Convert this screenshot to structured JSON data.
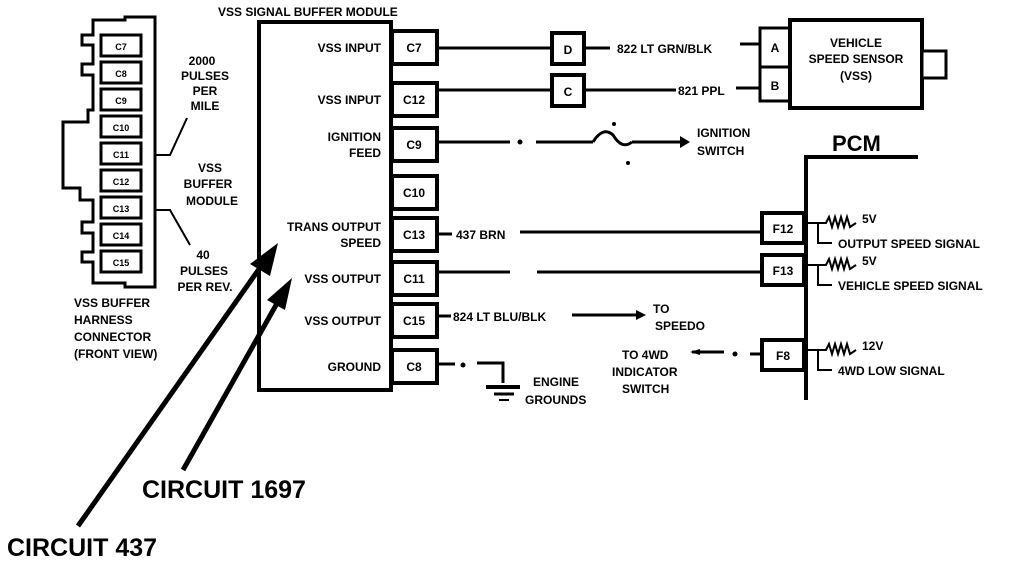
{
  "title": "VSS SIGNAL BUFFER MODULE",
  "connector": {
    "pins": [
      "C7",
      "C8",
      "C9",
      "C10",
      "C11",
      "C12",
      "C13",
      "C14",
      "C15"
    ],
    "label_lines": [
      "VSS BUFFER",
      "HARNESS",
      "CONNECTOR",
      "(FRONT VIEW)"
    ],
    "note_top": [
      "2000",
      "PULSES",
      "PER",
      "MILE"
    ],
    "note_mid": [
      "VSS",
      "BUFFER",
      "MODULE"
    ],
    "note_bottom": [
      "40",
      "PULSES",
      "PER REV."
    ]
  },
  "module": {
    "rows": [
      {
        "label": [
          "VSS INPUT"
        ],
        "pin": "C7"
      },
      {
        "label": [
          "VSS INPUT"
        ],
        "pin": "C12"
      },
      {
        "label": [
          "IGNITION",
          "FEED"
        ],
        "pin": "C9"
      },
      {
        "label": [],
        "pin": "C10"
      },
      {
        "label": [
          "TRANS OUTPUT",
          "SPEED"
        ],
        "pin": "C13"
      },
      {
        "label": [
          "VSS OUTPUT"
        ],
        "pin": "C11"
      },
      {
        "label": [
          "VSS OUTPUT"
        ],
        "pin": "C15"
      },
      {
        "label": [
          "GROUND"
        ],
        "pin": "C8"
      }
    ]
  },
  "wires": {
    "c7": {
      "connector": "D",
      "label": "822 LT GRN/BLK",
      "sensor_pin": "A"
    },
    "c12": {
      "connector": "C",
      "label": "821 PPL",
      "sensor_pin": "B"
    },
    "c9": {
      "dest": [
        "IGNITION",
        "SWITCH"
      ]
    },
    "c13": {
      "label": "437 BRN"
    },
    "c15": {
      "label": "824 LT BLU/BLK",
      "dest": [
        "TO",
        "SPEEDO"
      ]
    },
    "c8": {
      "dest": [
        "ENGINE",
        "GROUNDS"
      ]
    }
  },
  "sensor": {
    "lines": [
      "VEHICLE",
      "SPEED SENSOR",
      "(VSS)"
    ]
  },
  "pcm": {
    "title": "PCM",
    "terminals": [
      {
        "pin": "F12",
        "voltage": "5V",
        "signal": "OUTPUT SPEED SIGNAL"
      },
      {
        "pin": "F13",
        "voltage": "5V",
        "signal": "VEHICLE SPEED SIGNAL"
      },
      {
        "pin": "F8",
        "voltage": "12V",
        "signal": "4WD LOW SIGNAL"
      }
    ],
    "f8_source": [
      "TO 4WD",
      "INDICATOR",
      "SWITCH"
    ]
  },
  "callouts": {
    "circuit_1697": "CIRCUIT 1697",
    "circuit_437": "CIRCUIT 437"
  }
}
